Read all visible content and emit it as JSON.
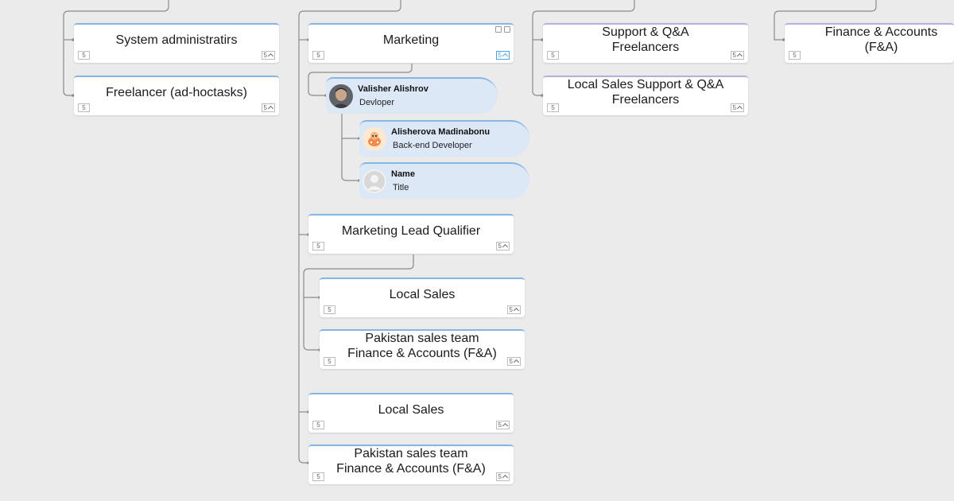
{
  "column1": {
    "cards": [
      {
        "title": "System administratirs",
        "count_left": "5",
        "count_right": "5"
      },
      {
        "title": "Freelancer (ad-hoctasks)",
        "count_left": "5",
        "count_right": "5"
      }
    ]
  },
  "column2": {
    "marketing": {
      "title": "Marketing",
      "count_left": "5",
      "count_right": "5"
    },
    "people": [
      {
        "name": "Valisher Alishrov",
        "title": "Devloper"
      },
      {
        "name": "Alisherova Madinabonu",
        "title": "Back-end Developer"
      },
      {
        "name": "Name",
        "title": "Title"
      }
    ],
    "lead_qualifier": {
      "title": "Marketing Lead Qualifier",
      "count_left": "5",
      "count_right": "5"
    },
    "sub_cards": [
      {
        "line1": "Local Sales",
        "line2": "",
        "count_left": "5",
        "count_right": "5"
      },
      {
        "line1": "Pakistan sales team",
        "line2": "Finance & Accounts (F&A)",
        "count_left": "5",
        "count_right": "5"
      }
    ],
    "bottom_cards": [
      {
        "line1": "Local Sales",
        "line2": "",
        "count_left": "5",
        "count_right": "5"
      },
      {
        "line1": "Pakistan sales team",
        "line2": "Finance & Accounts (F&A)",
        "count_left": "5",
        "count_right": "5"
      }
    ]
  },
  "column3": {
    "cards": [
      {
        "line1": "Support & Q&A",
        "line2": "Freelancers",
        "count_left": "5",
        "count_right": "5"
      },
      {
        "line1": "Local Sales Support & Q&A",
        "line2": "Freelancers",
        "count_left": "5",
        "count_right": "5"
      }
    ]
  },
  "column4": {
    "cards": [
      {
        "line1": "Finance & Accounts",
        "line2": "(F&A)",
        "count_left": "5"
      }
    ]
  },
  "colors": {
    "background": "#ebebeb",
    "card_accent": "#86b6e6",
    "card_accent_purple": "#b9aee2",
    "person_bg": "#dde8f7",
    "connector": "#8a8a8a",
    "active_count": "#4aa3df"
  }
}
